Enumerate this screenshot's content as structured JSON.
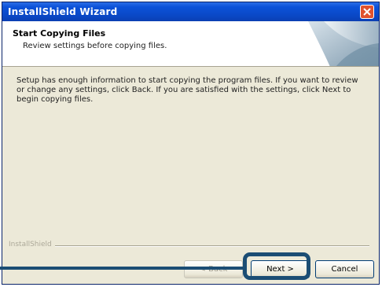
{
  "window": {
    "title": "InstallShield Wizard",
    "close_icon": "close-icon"
  },
  "header": {
    "title": "Start Copying Files",
    "subtitle": "Review settings before copying files."
  },
  "body": {
    "text": "Setup has enough information to start copying the program files.  If you want to review or change any settings, click Back.  If you are satisfied with the settings, click Next to begin copying files."
  },
  "footer": {
    "brand": "InstallShield"
  },
  "buttons": {
    "back": "< Back",
    "next": "Next >",
    "cancel": "Cancel"
  },
  "colors": {
    "titlebar": "#0a48c6",
    "dialog": "#ece9d8",
    "highlight": "#1b4d74",
    "close": "#e0522e"
  }
}
